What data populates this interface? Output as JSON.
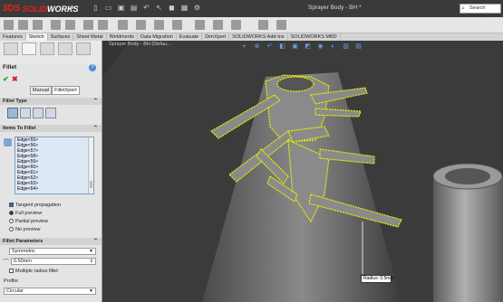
{
  "app": {
    "brand_ds": "3DS",
    "brand_solid": "SOLID",
    "brand_works": "WORKS",
    "document_title": "Sprayer Body - BH *",
    "search_placeholder": "Search Comman"
  },
  "command_tabs": [
    "Features",
    "Sketch",
    "Surfaces",
    "Sheet Metal",
    "Weldments",
    "Data Migration",
    "Evaluate",
    "DimXpert",
    "SOLIDWORKS Add-Ins",
    "SOLIDWORKS MBD"
  ],
  "active_tab": "Sketch",
  "property_manager": {
    "title": "Fillet",
    "modes": [
      "Manual",
      "FilletXpert"
    ],
    "fillet_type_header": "Fillet Type",
    "items_header": "Items To Fillet",
    "edges": [
      "Edge<55>",
      "Edge<56>",
      "Edge<57>",
      "Edge<58>",
      "Edge<59>",
      "Edge<60>",
      "Edge<61>",
      "Edge<62>",
      "Edge<63>",
      "Edge<64>"
    ],
    "tangent_propagation": "Tangent propagation",
    "tangent_propagation_checked": true,
    "preview_options": [
      "Full preview",
      "Partial preview",
      "No preview"
    ],
    "preview_selected": "Full preview",
    "params_header": "Fillet Parameters",
    "method": "Symmetric",
    "radius": "0.50mm",
    "multiple_radius": "Multiple radius fillet",
    "profile_label": "Profile:",
    "profile": "Circular"
  },
  "viewport": {
    "breadcrumb": "Sprayer Body - BH (Defau...",
    "radius_label": "Radius:",
    "radius_value": "0.5mm"
  },
  "colors": {
    "brand_red": "#e2231a",
    "highlight_yellow": "#e8f000",
    "viewport_bg": "#2e2e2e"
  },
  "icons": {
    "help": "help-icon",
    "ok": "check-icon",
    "cancel": "close-icon"
  }
}
